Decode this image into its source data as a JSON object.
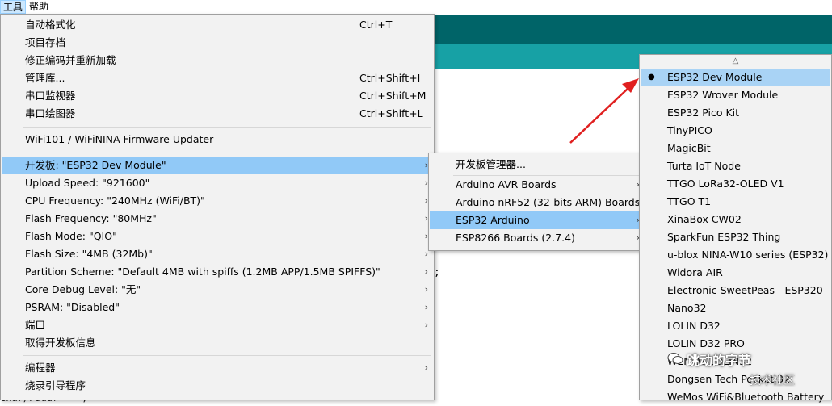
{
  "menubar": {
    "tools": "工具",
    "help": "帮助"
  },
  "tools_menu": {
    "items": [
      {
        "label": "自动格式化",
        "shortcut": "Ctrl+T"
      },
      {
        "label": "项目存档",
        "shortcut": ""
      },
      {
        "label": "修正编码并重新加载",
        "shortcut": ""
      },
      {
        "label": "管理库...",
        "shortcut": "Ctrl+Shift+I"
      },
      {
        "label": "串口监视器",
        "shortcut": "Ctrl+Shift+M"
      },
      {
        "label": "串口绘图器",
        "shortcut": "Ctrl+Shift+L"
      },
      {
        "label": "WiFi101 / WiFiNINA Firmware Updater",
        "shortcut": ""
      },
      {
        "label": "开发板: \"ESP32 Dev Module\""
      },
      {
        "label": "Upload Speed: \"921600\""
      },
      {
        "label": "CPU Frequency: \"240MHz (WiFi/BT)\""
      },
      {
        "label": "Flash Frequency: \"80MHz\""
      },
      {
        "label": "Flash Mode: \"QIO\""
      },
      {
        "label": "Flash Size: \"4MB (32Mb)\""
      },
      {
        "label": "Partition Scheme: \"Default 4MB with spiffs (1.2MB APP/1.5MB SPIFFS)\""
      },
      {
        "label": "Core Debug Level: \"无\""
      },
      {
        "label": "PSRAM: \"Disabled\""
      },
      {
        "label": "端口"
      },
      {
        "label": "取得开发板信息"
      },
      {
        "label": "编程器"
      },
      {
        "label": "烧录引导程序"
      }
    ]
  },
  "board_menu": {
    "items": [
      {
        "label": "开发板管理器..."
      },
      {
        "label": "Arduino AVR Boards"
      },
      {
        "label": "Arduino nRF52 (32-bits ARM) Boards"
      },
      {
        "label": "ESP32 Arduino"
      },
      {
        "label": "ESP8266 Boards (2.7.4)"
      }
    ]
  },
  "esp32_menu": {
    "scroll_up": "△",
    "selected_bullet": "●",
    "items": [
      {
        "label": "ESP32 Dev Module"
      },
      {
        "label": "ESP32 Wrover Module"
      },
      {
        "label": "ESP32 Pico Kit"
      },
      {
        "label": "TinyPICO"
      },
      {
        "label": "MagicBit"
      },
      {
        "label": "Turta IoT Node"
      },
      {
        "label": "TTGO LoRa32-OLED V1"
      },
      {
        "label": "TTGO T1"
      },
      {
        "label": "XinaBox CW02"
      },
      {
        "label": "SparkFun ESP32 Thing"
      },
      {
        "label": "u-blox NINA-W10 series (ESP32)"
      },
      {
        "label": "Widora AIR"
      },
      {
        "label": "Electronic SweetPeas - ESP320"
      },
      {
        "label": "Nano32"
      },
      {
        "label": "LOLIN D32"
      },
      {
        "label": "LOLIN D32 PRO"
      },
      {
        "label": "WEMOS LOLIN32"
      },
      {
        "label": "Dongsen Tech Pocket 32"
      },
      {
        "label": "WeMos WiFi&Bluetooth Battery"
      }
    ]
  },
  "editor": {
    "semicolon": ";",
    "bottom_text": "char/Paddr  '=';"
  },
  "watermark": {
    "title": "跳动的字节",
    "subtitle": "技术社区"
  },
  "colors": {
    "highlight": "#91c9f7",
    "teal_dark": "#006468",
    "teal_light": "#17a1a5",
    "arrow": "#e02020"
  }
}
